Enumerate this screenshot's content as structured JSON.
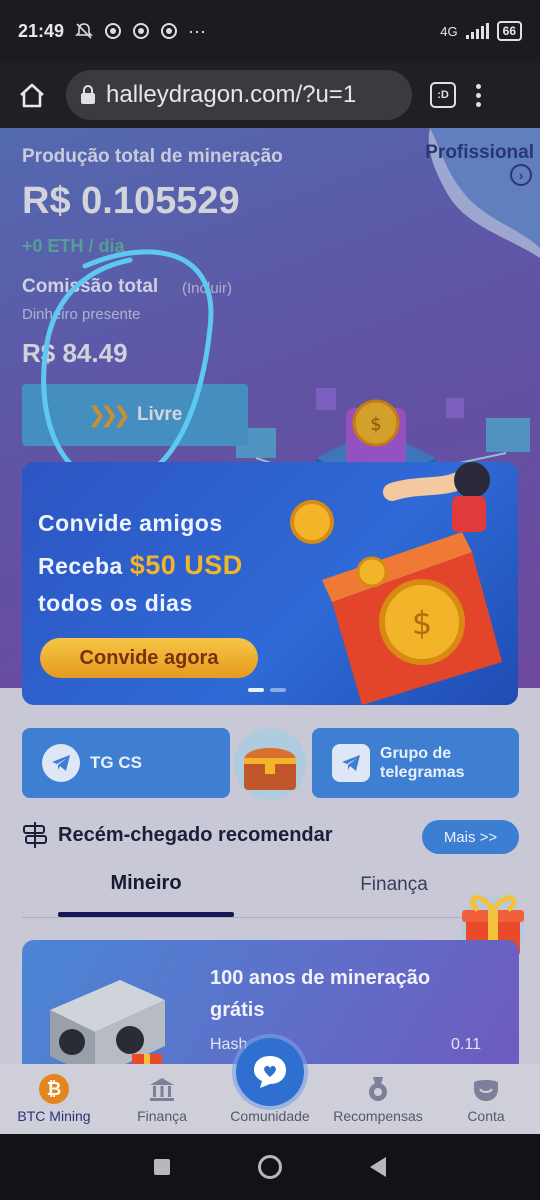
{
  "status_bar": {
    "time": "21:49",
    "network": "4G",
    "battery": "66"
  },
  "browser": {
    "url": "halleydragon.com/?u=1",
    "tabs_label": ":D"
  },
  "hero": {
    "production_title": "Produção total de mineração",
    "production_value": "R$ 0.105529",
    "eth_rate": "+0 ETH / dia",
    "commission_title": "Comissão total",
    "commission_include": "(Incluir)",
    "cash_label": "Dinheiro presente",
    "cash_value": "R$ 84.49",
    "free_button": "Livre",
    "pro_label": "Profissional"
  },
  "banner": {
    "line1": "Convide amigos",
    "line2_prefix": "Receba",
    "line2_highlight": "$50 USD",
    "line3": "todos os dias",
    "button": "Convide agora"
  },
  "telegram": {
    "cs_label": "TG CS",
    "group_label": "Grupo de telegramas"
  },
  "recommend": {
    "title": "Recém-chegado recomendar",
    "more": "Mais >>",
    "tabs": [
      {
        "label": "Mineiro",
        "active": true
      },
      {
        "label": "Finança",
        "active": false
      }
    ]
  },
  "miner_card": {
    "title": "100 anos de mineração grátis",
    "hash_label": "Hash",
    "hash_value": "0.11"
  },
  "bottom_nav": [
    {
      "label": "BTC Mining",
      "icon": "bitcoin-icon",
      "active": true
    },
    {
      "label": "Finança",
      "icon": "bank-icon",
      "active": false
    },
    {
      "label": "Comunidade",
      "icon": "chat-heart-icon",
      "active": false
    },
    {
      "label": "Recompensas",
      "icon": "medal-icon",
      "active": false
    },
    {
      "label": "Conta",
      "icon": "user-icon",
      "active": false
    }
  ],
  "colors": {
    "accent_blue": "#3f7fd2",
    "gold": "#f2b52a",
    "highlight_circle": "#5ec8f0"
  }
}
